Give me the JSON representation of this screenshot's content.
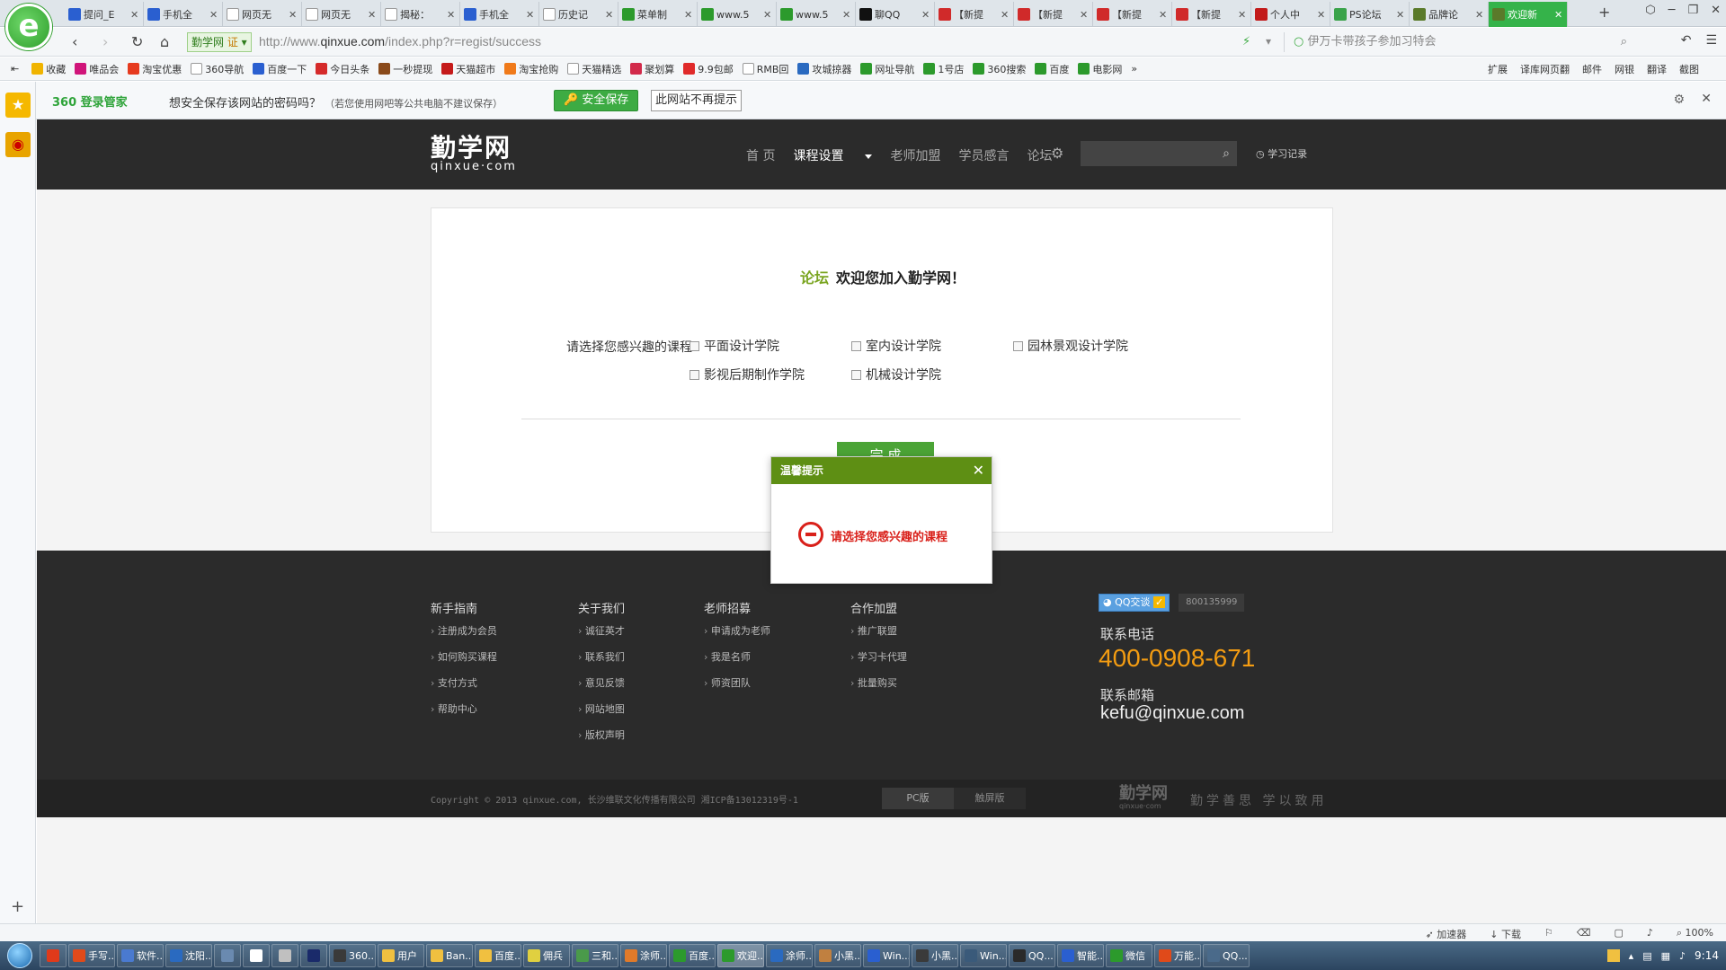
{
  "browser": {
    "tabs": [
      {
        "label": "提问_E",
        "color": "#2a5fd0"
      },
      {
        "label": "手机全",
        "color": "#2a5fd0"
      },
      {
        "label": "网页无",
        "color": "#ffffff"
      },
      {
        "label": "网页无",
        "color": "#ffffff"
      },
      {
        "label": "揭秘：",
        "color": "#ffffff"
      },
      {
        "label": "手机全",
        "color": "#2a5fd0"
      },
      {
        "label": "历史记",
        "color": "#ffffff"
      },
      {
        "label": "菜单制",
        "color": "#2c9a2c"
      },
      {
        "label": "www.5",
        "color": "#2c9a2c"
      },
      {
        "label": "www.5",
        "color": "#2c9a2c"
      },
      {
        "label": "聊QQ",
        "color": "#111111"
      },
      {
        "label": "【新提",
        "color": "#d02a2a"
      },
      {
        "label": "【新提",
        "color": "#d02a2a"
      },
      {
        "label": "【新提",
        "color": "#d02a2a"
      },
      {
        "label": "【新提",
        "color": "#d02a2a"
      },
      {
        "label": "个人中",
        "color": "#c21a1a"
      },
      {
        "label": "PS论坛",
        "color": "#3aa34a"
      },
      {
        "label": "品牌论",
        "color": "#5a7a2a"
      },
      {
        "label": "欢迎新",
        "color": "#5a7a2a",
        "active": true
      }
    ],
    "new_tab": "+",
    "window_controls": [
      "⬡",
      "─",
      "❐",
      "✕"
    ],
    "cert_label": "勤学网",
    "cert_badge": "证",
    "url_prefix": "http://www.",
    "url_host": "qinxue.com",
    "url_path": "/index.php?r=regist/success",
    "search_placeholder": "伊万卡带孩子参加习特会",
    "bookmarks": [
      {
        "label": "收藏",
        "color": "#f0b400"
      },
      {
        "label": "唯品会",
        "color": "#d0147a"
      },
      {
        "label": "淘宝优惠",
        "color": "#e63a1e"
      },
      {
        "label": "360导航",
        "color": "#ffffff"
      },
      {
        "label": "百度一下",
        "color": "#2a5fd0"
      },
      {
        "label": "今日头条",
        "color": "#d52a2a"
      },
      {
        "label": "一秒提现",
        "color": "#8a4a1a"
      },
      {
        "label": "天猫超市",
        "color": "#c51a1a"
      },
      {
        "label": "淘宝抢购",
        "color": "#f07a1a"
      },
      {
        "label": "天猫精选",
        "color": "#ffffff"
      },
      {
        "label": "聚划算",
        "color": "#d22a4a"
      },
      {
        "label": "9.9包邮",
        "color": "#e02a2a"
      },
      {
        "label": "RMB回",
        "color": "#ffffff"
      },
      {
        "label": "攻城掠器",
        "color": "#2a6ac0"
      },
      {
        "label": "网址导航",
        "color": "#2c9a2c"
      },
      {
        "label": "1号店",
        "color": "#2c9a2c"
      },
      {
        "label": "360搜索",
        "color": "#2c9a2c"
      },
      {
        "label": "百度",
        "color": "#2c9a2c"
      },
      {
        "label": "电影网",
        "color": "#2c9a2c"
      }
    ],
    "bookmarks_more": "»",
    "bookmarks_right": [
      "扩展",
      "译库网页翻",
      "邮件",
      "网银",
      "翻译",
      "截图"
    ],
    "password_bar": {
      "brand": "360 登录管家",
      "question": "想安全保存该网站的密码吗？",
      "note": "（若您使用网吧等公共电脑不建议保存）",
      "save_label": "安全保存",
      "never_label": "此网站不再提示"
    },
    "status_right": [
      "加速器",
      "下载",
      "100%"
    ]
  },
  "site": {
    "logo_cn": "勤学网",
    "logo_en": "qinxue·com",
    "nav": [
      "首 页",
      "课程设置",
      "老师加盟",
      "学员感言",
      "论坛"
    ],
    "history_label": "学习记录",
    "welcome_prefix": "论坛",
    "welcome_text": "欢迎您加入勤学网！",
    "interest_label": "请选择您感兴趣的课程：",
    "courses": [
      "平面设计学院",
      "室内设计学院",
      "园林景观设计学院",
      "影视后期制作学院",
      "机械设计学院"
    ],
    "finish_label": "完 成",
    "footer": {
      "columns": [
        {
          "title": "新手指南",
          "links": [
            "注册成为会员",
            "如何购买课程",
            "支付方式",
            "帮助中心"
          ]
        },
        {
          "title": "关于我们",
          "links": [
            "诚征英才",
            "联系我们",
            "意见反馈",
            "网站地图",
            "版权声明"
          ]
        },
        {
          "title": "老师招募",
          "links": [
            "申请成为老师",
            "我是名师",
            "师资团队"
          ]
        },
        {
          "title": "合作加盟",
          "links": [
            "推广联盟",
            "学习卡代理",
            "批量购买"
          ]
        }
      ],
      "qq_label": "QQ交谈",
      "qq_number": "800135999",
      "tel_label": "联系电话",
      "tel": "400-0908-671",
      "mail_label": "联系邮箱",
      "mail": "kefu@qinxue.com",
      "copyright": "Copyright © 2013 qinxue.com, 长沙维联文化传播有限公司 湘ICP备13012319号-1",
      "pc_label": "PC版",
      "touch_label": "触屏版",
      "foot_logo_cn": "勤学网",
      "foot_logo_en": "qinxue·com",
      "slogan": "勤学善思 学以致用"
    }
  },
  "modal": {
    "title": "温馨提示",
    "message": "请选择您感兴趣的课程"
  },
  "taskbar": {
    "items": [
      {
        "label": "",
        "color": "#e03a1a",
        "small": true
      },
      {
        "label": "手写...",
        "color": "#e04a1a"
      },
      {
        "label": "软件...",
        "color": "#4a7ad0"
      },
      {
        "label": "沈阳...",
        "color": "#2a6ac0"
      },
      {
        "label": "",
        "color": "#6a8ab0",
        "small": true
      },
      {
        "label": "",
        "color": "#ffffff",
        "small": true
      },
      {
        "label": "",
        "color": "#c0c0c0",
        "small": true
      },
      {
        "label": "",
        "color": "#1a2a6a",
        "small": true
      },
      {
        "label": "360...",
        "color": "#3a3a3a"
      },
      {
        "label": "用户",
        "color": "#f0c040"
      },
      {
        "label": "Ban...",
        "color": "#f0c040"
      },
      {
        "label": "百度...",
        "color": "#f0c040"
      },
      {
        "label": "佣兵",
        "color": "#e0d040"
      },
      {
        "label": "三和...",
        "color": "#4a9a4a"
      },
      {
        "label": "涂师...",
        "color": "#e07a2a"
      },
      {
        "label": "百度...",
        "color": "#2c9a2c"
      },
      {
        "label": "欢迎...",
        "color": "#2c9a2c",
        "active": true
      },
      {
        "label": "涂师...",
        "color": "#2a6ac0"
      },
      {
        "label": "小黑...",
        "color": "#c08040"
      },
      {
        "label": "Win...",
        "color": "#2a5fd0"
      },
      {
        "label": "小黑...",
        "color": "#3a3a3a"
      },
      {
        "label": "Win...",
        "color": "#3a5a7a"
      },
      {
        "label": "QQ...",
        "color": "#2a2a2a"
      },
      {
        "label": "智能...",
        "color": "#2a5fd0"
      },
      {
        "label": "微信",
        "color": "#2c9a2c"
      },
      {
        "label": "万能...",
        "color": "#e04a1a"
      },
      {
        "label": "QQ...",
        "color": "#4a6a8a"
      }
    ],
    "clock": "9:14"
  },
  "colors": {
    "brand_green": "#4ba436",
    "modal_green": "#5e8f14",
    "error_red": "#d9201a",
    "phone_orange": "#f39c12"
  }
}
